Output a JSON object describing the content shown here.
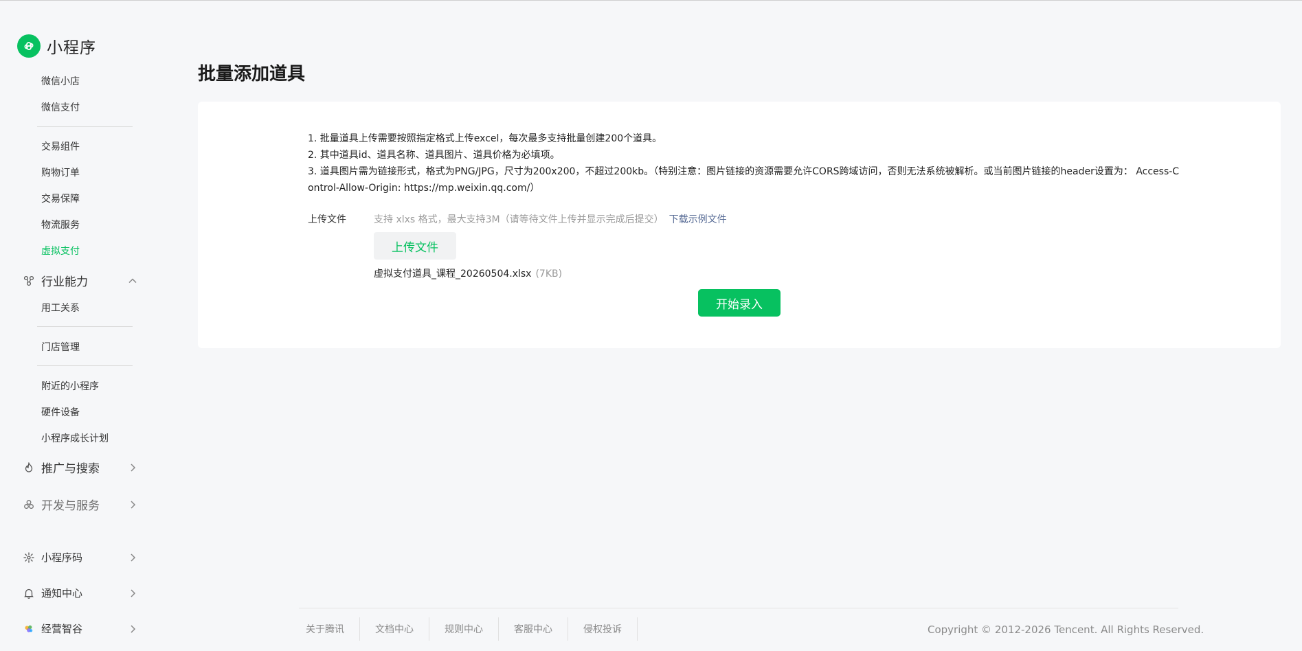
{
  "sidebar": {
    "brand": "小程序",
    "items_top": [
      {
        "label": "微信小店"
      },
      {
        "label": "微信支付"
      }
    ],
    "items_trade": [
      {
        "label": "交易组件"
      },
      {
        "label": "购物订单"
      },
      {
        "label": "交易保障"
      },
      {
        "label": "物流服务"
      },
      {
        "label": "虚拟支付"
      }
    ],
    "group_industry": "行业能力",
    "items_industry_1": [
      {
        "label": "用工关系"
      }
    ],
    "items_industry_2": [
      {
        "label": "门店管理"
      }
    ],
    "items_industry_3": [
      {
        "label": "附近的小程序"
      },
      {
        "label": "硬件设备"
      },
      {
        "label": "小程序成长计划"
      }
    ],
    "group_promo": "推广与搜索",
    "group_dev": "开发与服务",
    "group_code": "小程序码",
    "group_notice": "通知中心",
    "group_ai": "经营智谷"
  },
  "main": {
    "title": "批量添加道具",
    "instructions": [
      "1. 批量道具上传需要按照指定格式上传excel，每次最多支持批量创建200个道具。",
      "2. 其中道具id、道具名称、道具图片、道具价格为必填项。",
      "3. 道具图片需为链接形式，格式为PNG/JPG，尺寸为200x200，不超过200kb。（特别注意：图片链接的资源需要允许CORS跨域访问，否则无法系统被解析。或当前图片链接的header设置为： Access-Control-Allow-Origin: https://mp.weixin.qq.com/）"
    ],
    "upload_label": "上传文件",
    "upload_hint": "支持 xlxs 格式，最大支持3M（请等待文件上传并显示完成后提交）",
    "download_link": "下载示例文件",
    "upload_button": "上传文件",
    "file_name": "虚拟支付道具_课程_20260504.xlsx",
    "file_size": "(7KB)",
    "start_button": "开始录入"
  },
  "footer": {
    "links": [
      "关于腾讯",
      "文档中心",
      "规则中心",
      "客服中心",
      "侵权投诉"
    ],
    "copyright": "Copyright © 2012-2026 Tencent. All Rights Reserved."
  },
  "colors": {
    "brand_green": "#07c160",
    "link_blue": "#576b95"
  }
}
